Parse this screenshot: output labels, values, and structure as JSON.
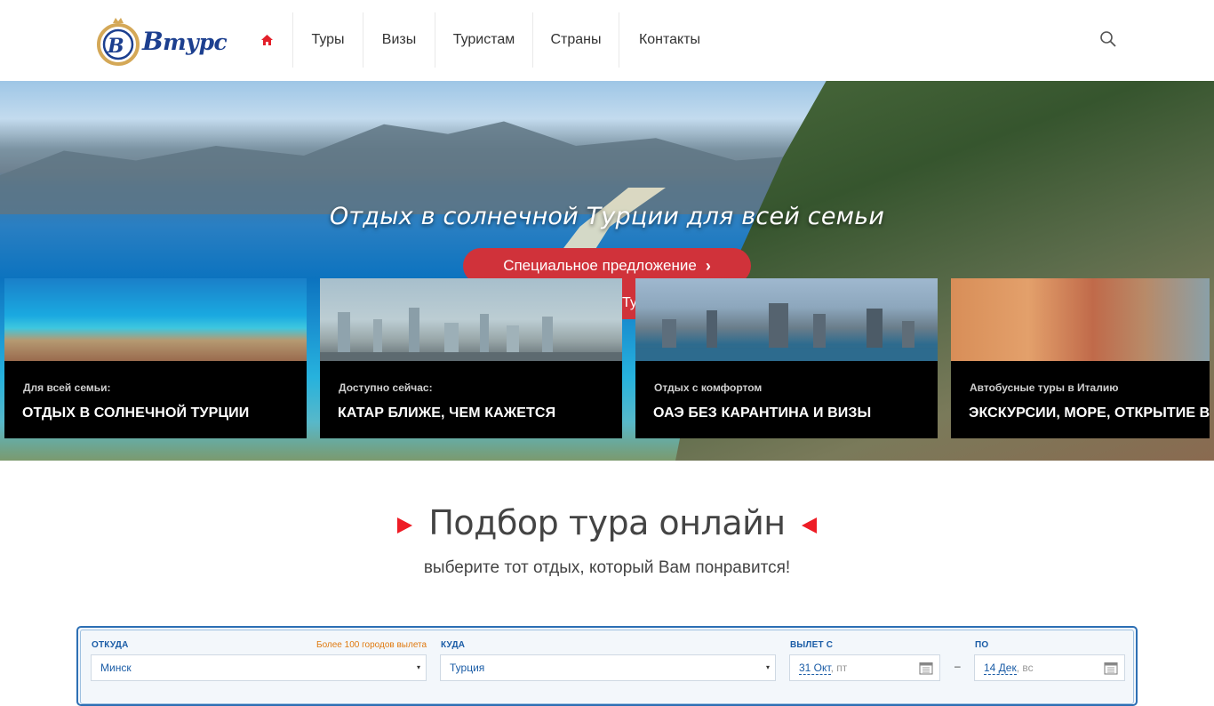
{
  "header": {
    "logo_text": "Втурс",
    "logo_letter": "В",
    "nav": [
      {
        "label": "Туры"
      },
      {
        "label": "Визы"
      },
      {
        "label": "Туристам"
      },
      {
        "label": "Страны"
      },
      {
        "label": "Контакты"
      }
    ],
    "icons": {
      "home": "home-icon",
      "search": "search-icon"
    }
  },
  "hero": {
    "title": "Отдых в солнечной Турции для всей семьи",
    "button_label": "Специальное предложение",
    "button_chevron": "›",
    "ghost_text": "Тур"
  },
  "cards": [
    {
      "subtitle": "Для всей семьи:",
      "title": "ОТДЫХ В СОЛНЕЧНОЙ ТУРЦИИ"
    },
    {
      "subtitle": "Доступно сейчас:",
      "title": "КАТАР БЛИЖЕ, ЧЕМ КАЖЕТСЯ"
    },
    {
      "subtitle": "Отдых с комфортом",
      "title": "ОАЭ БЕЗ КАРАНТИНА И ВИЗЫ"
    },
    {
      "subtitle": "Автобусные туры в Италию",
      "title": "ЭКСКУРСИИ, МОРЕ, ОТКРЫТИЕ ВИ"
    }
  ],
  "section": {
    "title": "Подбор тура онлайн",
    "subtitle": "выберите тот отдых, который Вам понравится!"
  },
  "search_form": {
    "from_label": "ОТКУДА",
    "from_note": "Более 100 городов вылета",
    "from_value": "Минск",
    "to_label": "КУДА",
    "to_value": "Турция",
    "depart_label": "ВЫЛЕТ С",
    "depart_date": "31 Окт",
    "depart_dow": ", пт",
    "until_label": "ПО",
    "until_date": "14 Дек",
    "until_dow": ", вс",
    "range_dash": "–"
  },
  "colors": {
    "accent_red": "#d0323a",
    "triangle_red": "#ee1c25",
    "form_blue": "#2d6fb4",
    "logo_blue": "#1c3f8f",
    "logo_gold": "#d4a857"
  }
}
